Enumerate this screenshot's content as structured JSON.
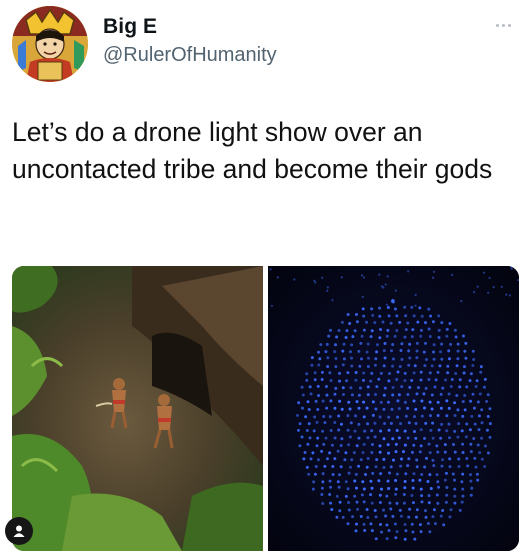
{
  "author": {
    "display_name": "Big E",
    "handle": "@RulerOfHumanity",
    "avatar_icon": "cartoon-ruler-avatar"
  },
  "tweet": {
    "text": "Let’s do a drone light show over an uncontacted tribe and become their gods"
  },
  "media": [
    {
      "description_icon": "jungle-tribe-photo"
    },
    {
      "description_icon": "drone-face-photo"
    }
  ],
  "colors": {
    "text_primary": "#0f1419",
    "text_secondary": "#536471",
    "drone_light": "#3d6bff"
  },
  "icons": {
    "more": "more-dots-icon",
    "profile_badge": "user-badge-icon"
  }
}
